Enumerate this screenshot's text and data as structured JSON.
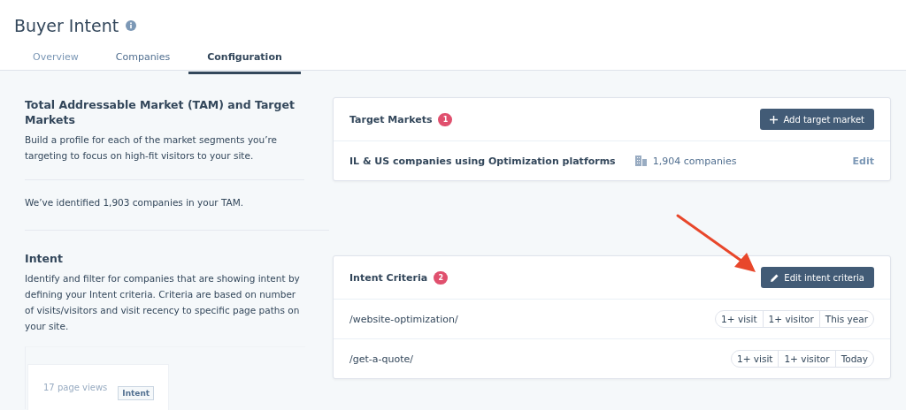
{
  "header": {
    "title": "Buyer Intent"
  },
  "tabs": [
    {
      "label": "Overview",
      "selected": false
    },
    {
      "label": "Companies",
      "selected": false
    },
    {
      "label": "Configuration",
      "selected": true
    }
  ],
  "tam_section": {
    "heading": "Total Addressable Market (TAM) and Target Markets",
    "description": "Build a profile for each of the market segments you’re targeting to focus on high-fit visitors to your site.",
    "summary": "We’ve identified 1,903 companies in your TAM."
  },
  "intent_section": {
    "heading": "Intent",
    "description": "Identify and filter for companies that are showing intent by defining your Intent criteria. Criteria are based on number of visits/visitors and visit recency to specific page paths on your site.",
    "preview": {
      "text": "17 page views",
      "badge": "Intent"
    }
  },
  "target_markets": {
    "title": "Target Markets",
    "count": "1",
    "button": "Add target market",
    "rows": [
      {
        "name": "IL & US companies using Optimization platforms",
        "companies": "1,904 companies",
        "action": "Edit"
      }
    ]
  },
  "intent_criteria": {
    "title": "Intent Criteria",
    "count": "2",
    "button": "Edit intent criteria",
    "rows": [
      {
        "path": "/website-optimization/",
        "tags": [
          "1+ visit",
          "1+ visitor",
          "This year"
        ]
      },
      {
        "path": "/get-a-quote/",
        "tags": [
          "1+ visit",
          "1+ visitor",
          "Today"
        ]
      }
    ]
  }
}
